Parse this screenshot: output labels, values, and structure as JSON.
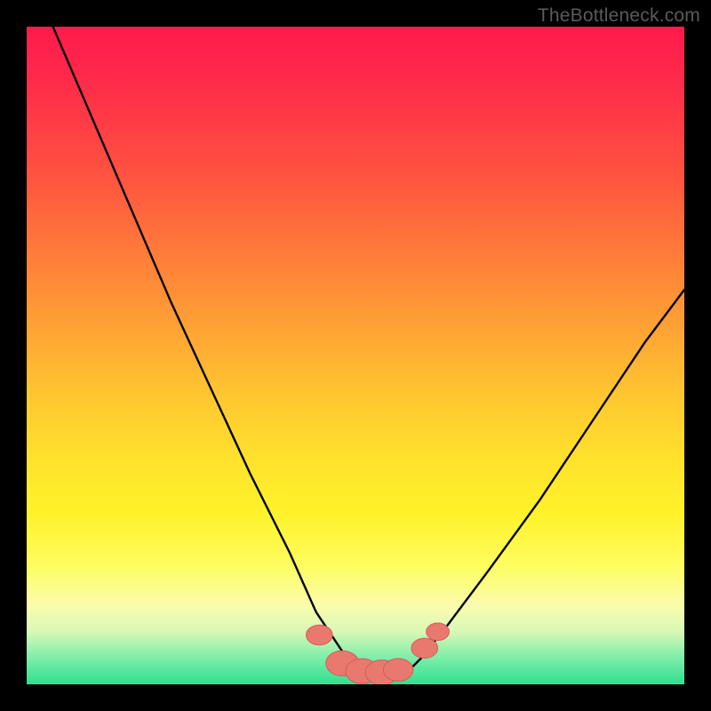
{
  "watermark": "TheBottleneck.com",
  "chart_data": {
    "type": "line",
    "title": "",
    "xlabel": "",
    "ylabel": "",
    "xlim": [
      0,
      100
    ],
    "ylim": [
      0,
      100
    ],
    "grid": false,
    "legend": false,
    "series": [
      {
        "name": "bottleneck-curve",
        "x": [
          4,
          10,
          16,
          22,
          28,
          34,
          40,
          44,
          48,
          50,
          52,
          54,
          56,
          58,
          60,
          64,
          70,
          78,
          86,
          94,
          100
        ],
        "y": [
          100,
          86,
          72,
          58,
          45,
          32,
          20,
          11,
          5,
          2,
          1,
          1,
          1,
          2,
          4,
          9,
          17,
          28,
          40,
          52,
          60
        ]
      }
    ],
    "markers": [
      {
        "name": "left-spot-1",
        "x": 44.5,
        "y": 7.5,
        "r": 1.6
      },
      {
        "name": "bottom-blob-1",
        "x": 48,
        "y": 3.2,
        "r": 2.0
      },
      {
        "name": "bottom-blob-2",
        "x": 51,
        "y": 2.0,
        "r": 2.0
      },
      {
        "name": "bottom-blob-3",
        "x": 54,
        "y": 1.8,
        "r": 2.0
      },
      {
        "name": "bottom-blob-4",
        "x": 56.5,
        "y": 2.2,
        "r": 1.8
      },
      {
        "name": "right-spot-1",
        "x": 60.5,
        "y": 5.5,
        "r": 1.6
      },
      {
        "name": "right-spot-2",
        "x": 62.5,
        "y": 8.0,
        "r": 1.4
      }
    ],
    "colors": {
      "curve": "#000000",
      "marker_fill": "#e9786f",
      "marker_stroke": "#d45e57"
    }
  }
}
